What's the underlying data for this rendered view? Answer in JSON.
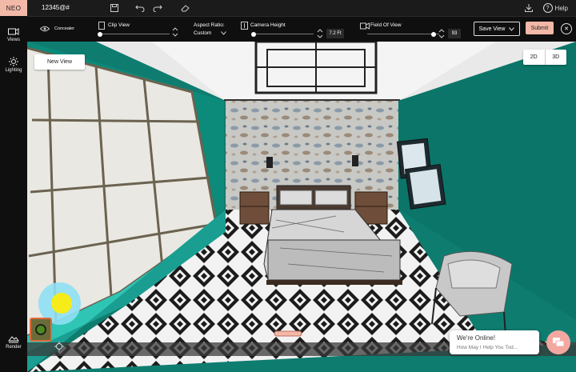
{
  "app": {
    "logo": "NEO",
    "project_name": "12345@#",
    "help_label": "Help"
  },
  "sidebar": {
    "items": [
      {
        "label": "Views",
        "icon": "camera-views-icon"
      },
      {
        "label": "Lighting",
        "icon": "sun-icon"
      },
      {
        "label": "Render",
        "icon": "render-icon"
      }
    ]
  },
  "toolbar": {
    "concealer_label": "Concealer",
    "clip_view_label": "Clip View",
    "aspect_ratio_label": "Aspect Ratio:",
    "aspect_ratio_value": "Custom",
    "camera_height_label": "Camera Height",
    "camera_height_value": "7.2 Ft",
    "field_of_view_label": "Field Of View",
    "field_of_view_value": "93",
    "save_view_label": "Save View",
    "submit_label": "Submit"
  },
  "viewport": {
    "new_view_label": "New View",
    "view_modes": [
      "2D",
      "3D"
    ]
  },
  "chat": {
    "title": "We're Online!",
    "subtitle": "How May I Help You Tod..."
  },
  "colors": {
    "accent": "#f2b8a8",
    "wall": "#0e7d70",
    "toolbar": "#0f0f0f"
  }
}
